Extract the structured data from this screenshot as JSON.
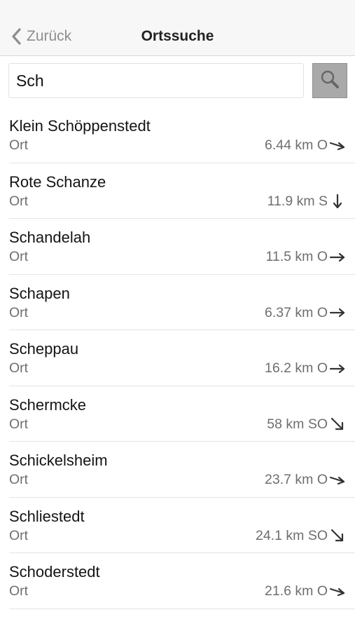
{
  "nav": {
    "back_label": "Zurück",
    "title": "Ortssuche"
  },
  "search": {
    "value": "Sch",
    "placeholder": ""
  },
  "results": [
    {
      "name": "Klein Schöppenstedt",
      "type": "Ort",
      "distance": "6.44 km O",
      "arrow": "east-southeast-arrow-icon"
    },
    {
      "name": "Rote Schanze",
      "type": "Ort",
      "distance": "11.9 km S",
      "arrow": "south-arrow-icon"
    },
    {
      "name": "Schandelah",
      "type": "Ort",
      "distance": "11.5 km O",
      "arrow": "east-arrow-icon"
    },
    {
      "name": "Schapen",
      "type": "Ort",
      "distance": "6.37 km O",
      "arrow": "east-arrow-icon"
    },
    {
      "name": "Scheppau",
      "type": "Ort",
      "distance": "16.2 km O",
      "arrow": "east-arrow-icon"
    },
    {
      "name": "Schermcke",
      "type": "Ort",
      "distance": "58 km SO",
      "arrow": "southeast-arrow-icon"
    },
    {
      "name": "Schickelsheim",
      "type": "Ort",
      "distance": "23.7 km O",
      "arrow": "east-southeast-arrow-icon"
    },
    {
      "name": "Schliestedt",
      "type": "Ort",
      "distance": "24.1 km SO",
      "arrow": "southeast-arrow-icon"
    },
    {
      "name": "Schoderstedt",
      "type": "Ort",
      "distance": "21.6 km O",
      "arrow": "east-southeast-arrow-icon"
    }
  ],
  "colors": {
    "navbar_bg": "#f7f7f7",
    "secondary_text": "#6e6e6e",
    "search_button": "#a9a9a9"
  }
}
